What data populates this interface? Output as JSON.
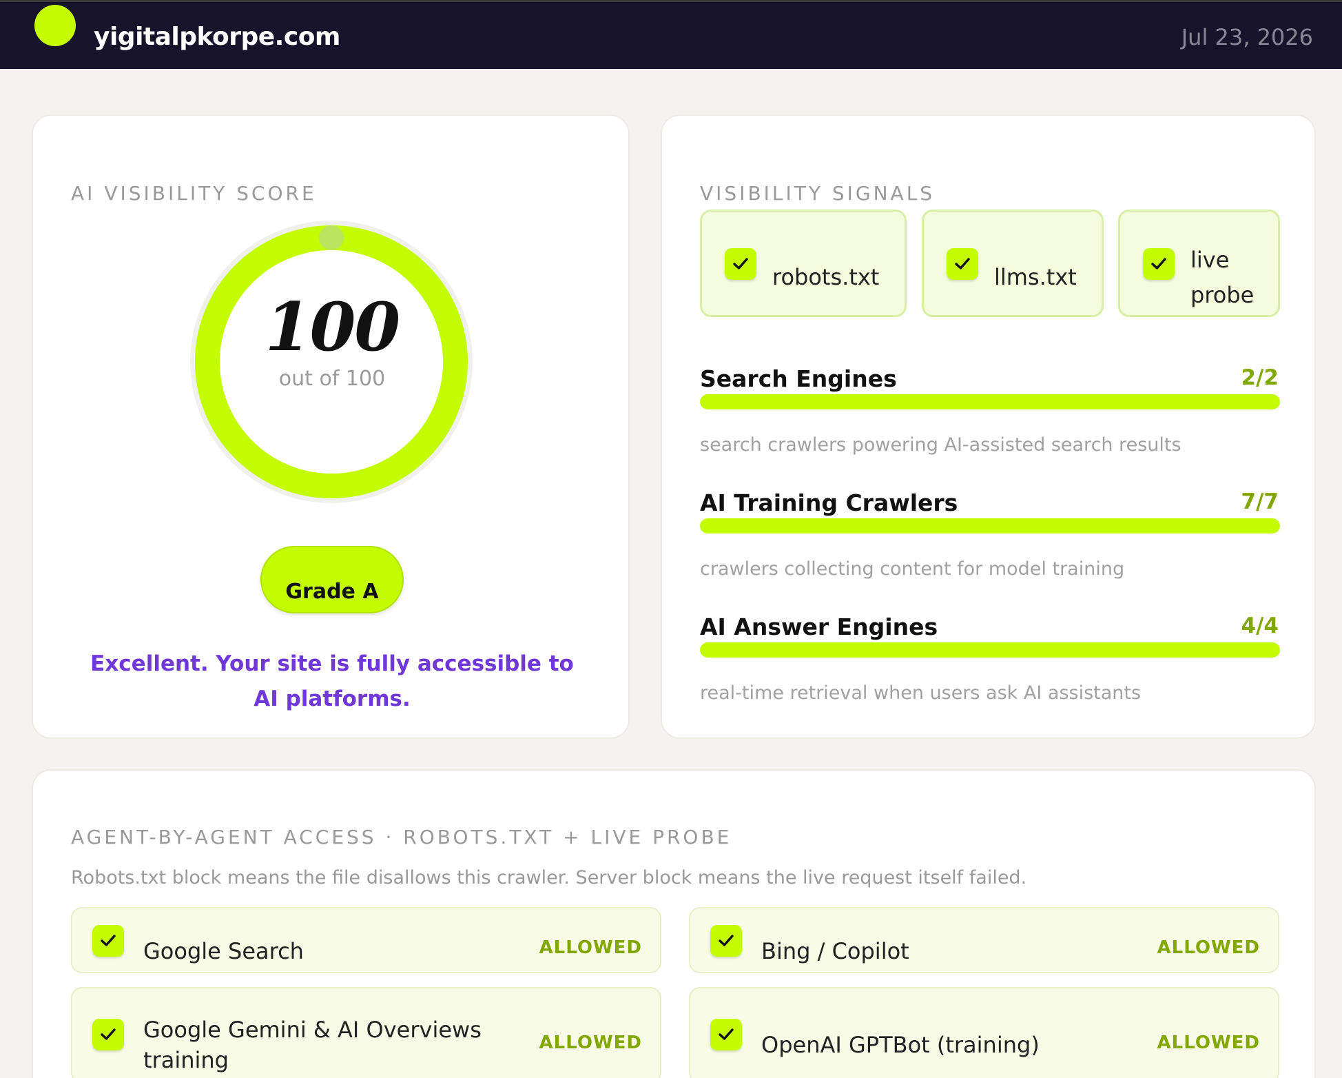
{
  "header": {
    "site": "yigitalpkorpe.com",
    "date": "Jul 23, 2026",
    "accent": "#c4fc00"
  },
  "score": {
    "label": "AI VISIBILITY SCORE",
    "value": "100",
    "subtitle": "out of 100",
    "fraction": 1.0,
    "grade": "Grade A",
    "message": "Excellent. Your site is fully accessible to AI platforms.",
    "message_color": "#7038d8"
  },
  "signals": {
    "label": "VISIBILITY SIGNALS",
    "chips": [
      {
        "label": "robots.txt",
        "icon": "check-icon"
      },
      {
        "label": "llms.txt",
        "icon": "check-icon"
      },
      {
        "label": "live probe",
        "icon": "check-icon"
      }
    ],
    "categories": [
      {
        "title": "Search Engines",
        "count": "2/2",
        "fraction": 1.0,
        "description": "search crawlers powering AI-assisted search results"
      },
      {
        "title": "AI Training Crawlers",
        "count": "7/7",
        "fraction": 1.0,
        "description": "crawlers collecting content for model training"
      },
      {
        "title": "AI Answer Engines",
        "count": "4/4",
        "fraction": 1.0,
        "description": "real-time retrieval when users ask AI assistants"
      }
    ]
  },
  "agents": {
    "label": "AGENT-BY-AGENT ACCESS · ROBOTS.TXT + LIVE PROBE",
    "note": "Robots.txt block means the file disallows this crawler. Server block means the live request itself failed.",
    "items": [
      {
        "name": "Google Search",
        "status": "ALLOWED"
      },
      {
        "name": "Bing / Copilot",
        "status": "ALLOWED"
      },
      {
        "name": "Google Gemini & AI Overviews training",
        "status": "ALLOWED"
      },
      {
        "name": "OpenAI GPTBot (training)",
        "status": "ALLOWED"
      }
    ]
  }
}
